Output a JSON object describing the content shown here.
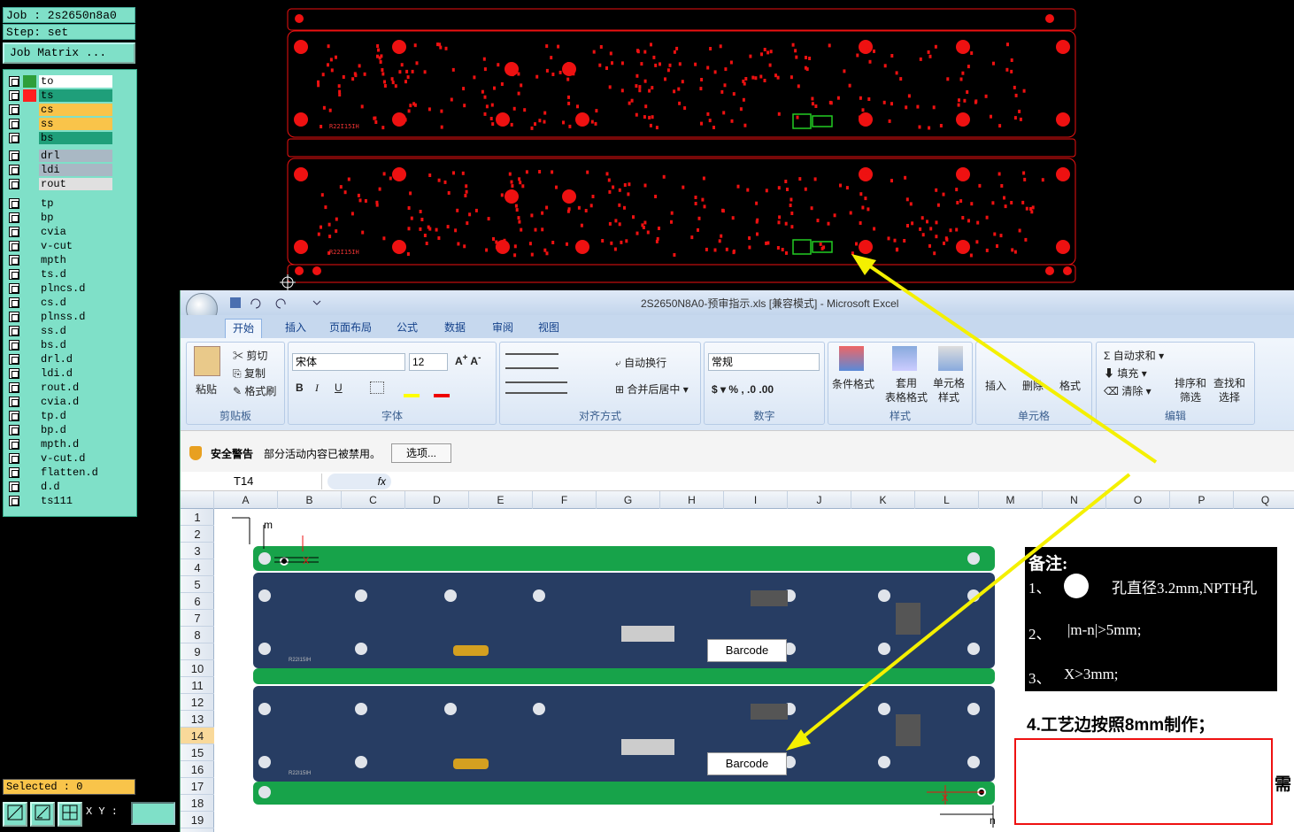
{
  "genesis": {
    "job_label": "Job : 2s2650n8a0",
    "step_label": "Step: set",
    "job_matrix_button": "Job Matrix ...",
    "layers": [
      {
        "name": "to",
        "color": "#ffffff",
        "swatch": "#2e9e3a"
      },
      {
        "name": "ts",
        "color": "#1f9f7a",
        "swatch": "#ff2020"
      },
      {
        "name": "cs",
        "color": "#f9c44a",
        "swatch": "#7fe0c8"
      },
      {
        "name": "ss",
        "color": "#f9c44a",
        "swatch": "#7fe0c8"
      },
      {
        "name": "bs",
        "color": "#1f9f7a",
        "swatch": "#7fe0c8"
      },
      {
        "name": "drl",
        "color": "#a9b8c4",
        "swatch": "#7fe0c8"
      },
      {
        "name": "ldi",
        "color": "#a9b8c4",
        "swatch": "#7fe0c8"
      },
      {
        "name": "rout",
        "color": "#e0e0e0",
        "swatch": "#7fe0c8"
      },
      {
        "name": "tp",
        "color": "#7fe0c8",
        "swatch": "#7fe0c8"
      },
      {
        "name": "bp",
        "color": "#7fe0c8",
        "swatch": "#7fe0c8"
      },
      {
        "name": "cvia",
        "color": "#7fe0c8",
        "swatch": "#7fe0c8"
      },
      {
        "name": "v-cut",
        "color": "#7fe0c8",
        "swatch": "#7fe0c8"
      },
      {
        "name": "mpth",
        "color": "#7fe0c8",
        "swatch": "#7fe0c8"
      },
      {
        "name": "ts.d",
        "color": "#7fe0c8",
        "swatch": "#7fe0c8"
      },
      {
        "name": "plncs.d",
        "color": "#7fe0c8",
        "swatch": "#7fe0c8"
      },
      {
        "name": "cs.d",
        "color": "#7fe0c8",
        "swatch": "#7fe0c8"
      },
      {
        "name": "plnss.d",
        "color": "#7fe0c8",
        "swatch": "#7fe0c8"
      },
      {
        "name": "ss.d",
        "color": "#7fe0c8",
        "swatch": "#7fe0c8"
      },
      {
        "name": "bs.d",
        "color": "#7fe0c8",
        "swatch": "#7fe0c8"
      },
      {
        "name": "drl.d",
        "color": "#7fe0c8",
        "swatch": "#7fe0c8"
      },
      {
        "name": "ldi.d",
        "color": "#7fe0c8",
        "swatch": "#7fe0c8"
      },
      {
        "name": "rout.d",
        "color": "#7fe0c8",
        "swatch": "#7fe0c8"
      },
      {
        "name": "cvia.d",
        "color": "#7fe0c8",
        "swatch": "#7fe0c8"
      },
      {
        "name": "tp.d",
        "color": "#7fe0c8",
        "swatch": "#7fe0c8"
      },
      {
        "name": "bp.d",
        "color": "#7fe0c8",
        "swatch": "#7fe0c8"
      },
      {
        "name": "mpth.d",
        "color": "#7fe0c8",
        "swatch": "#7fe0c8"
      },
      {
        "name": "v-cut.d",
        "color": "#7fe0c8",
        "swatch": "#7fe0c8"
      },
      {
        "name": "flatten.d",
        "color": "#7fe0c8",
        "swatch": "#7fe0c8"
      },
      {
        "name": "d.d",
        "color": "#7fe0c8",
        "swatch": "#7fe0c8"
      },
      {
        "name": "ts111",
        "color": "#7fe0c8",
        "swatch": "#7fe0c8"
      }
    ],
    "selected_label": "Selected : 0",
    "xy_label": "X Y :",
    "pcb_silk_top": "R22I15IH",
    "pcb_silk_bottom": "R22I15IH"
  },
  "excel": {
    "window_title": "2S2650N8A0-预审指示.xls  [兼容模式] - Microsoft Excel",
    "tabs": [
      "开始",
      "插入",
      "页面布局",
      "公式",
      "数据",
      "审阅",
      "视图"
    ],
    "clipboard": {
      "paste": "粘贴",
      "cut": "剪切",
      "copy": "复制",
      "format_painter": "格式刷",
      "group": "剪贴板"
    },
    "font": {
      "name": "宋体",
      "size": "12",
      "bold": "B",
      "italic": "I",
      "underline": "U",
      "group": "字体"
    },
    "alignment": {
      "wrap": "自动换行",
      "merge": "合并后居中",
      "group": "对齐方式"
    },
    "number": {
      "format": "常规",
      "group": "数字"
    },
    "styles": {
      "conditional": "条件格式",
      "table_format": "套用\n表格格式",
      "cell_styles": "单元格\n样式",
      "group": "样式"
    },
    "cells": {
      "insert": "插入",
      "delete": "删除",
      "format": "格式",
      "group": "单元格"
    },
    "editing": {
      "autosum": "自动求和",
      "fill": "填充",
      "clear": "清除",
      "sort": "排序和\n筛选",
      "find": "查找和\n选择",
      "group": "编辑"
    },
    "security": {
      "title": "安全警告",
      "message": "部分活动内容已被禁用。",
      "options_button": "选项..."
    },
    "name_box": "T14",
    "fx": "fx",
    "columns": [
      "A",
      "B",
      "C",
      "D",
      "E",
      "F",
      "G",
      "H",
      "I",
      "J",
      "K",
      "L",
      "M",
      "N",
      "O",
      "P",
      "Q"
    ],
    "rows": [
      "1",
      "2",
      "3",
      "4",
      "5",
      "6",
      "7",
      "8",
      "9",
      "10",
      "11",
      "12",
      "13",
      "14",
      "15",
      "16",
      "17",
      "18",
      "19"
    ],
    "selected_row": "14",
    "notes": {
      "title": "备注:",
      "line1_prefix": "1、",
      "line1_text": "孔直径3.2mm,NPTH孔",
      "line2_prefix": "2、",
      "line2_text": "|m-n|>5mm;",
      "line3_prefix": "3、",
      "line3_text": "X>3mm;"
    },
    "note4": "4.工艺边按照8mm制作；",
    "red_box_partial": "需",
    "dim_m": "m",
    "dim_n": "n",
    "dim_x": "X",
    "barcode_label": "Barcode"
  }
}
